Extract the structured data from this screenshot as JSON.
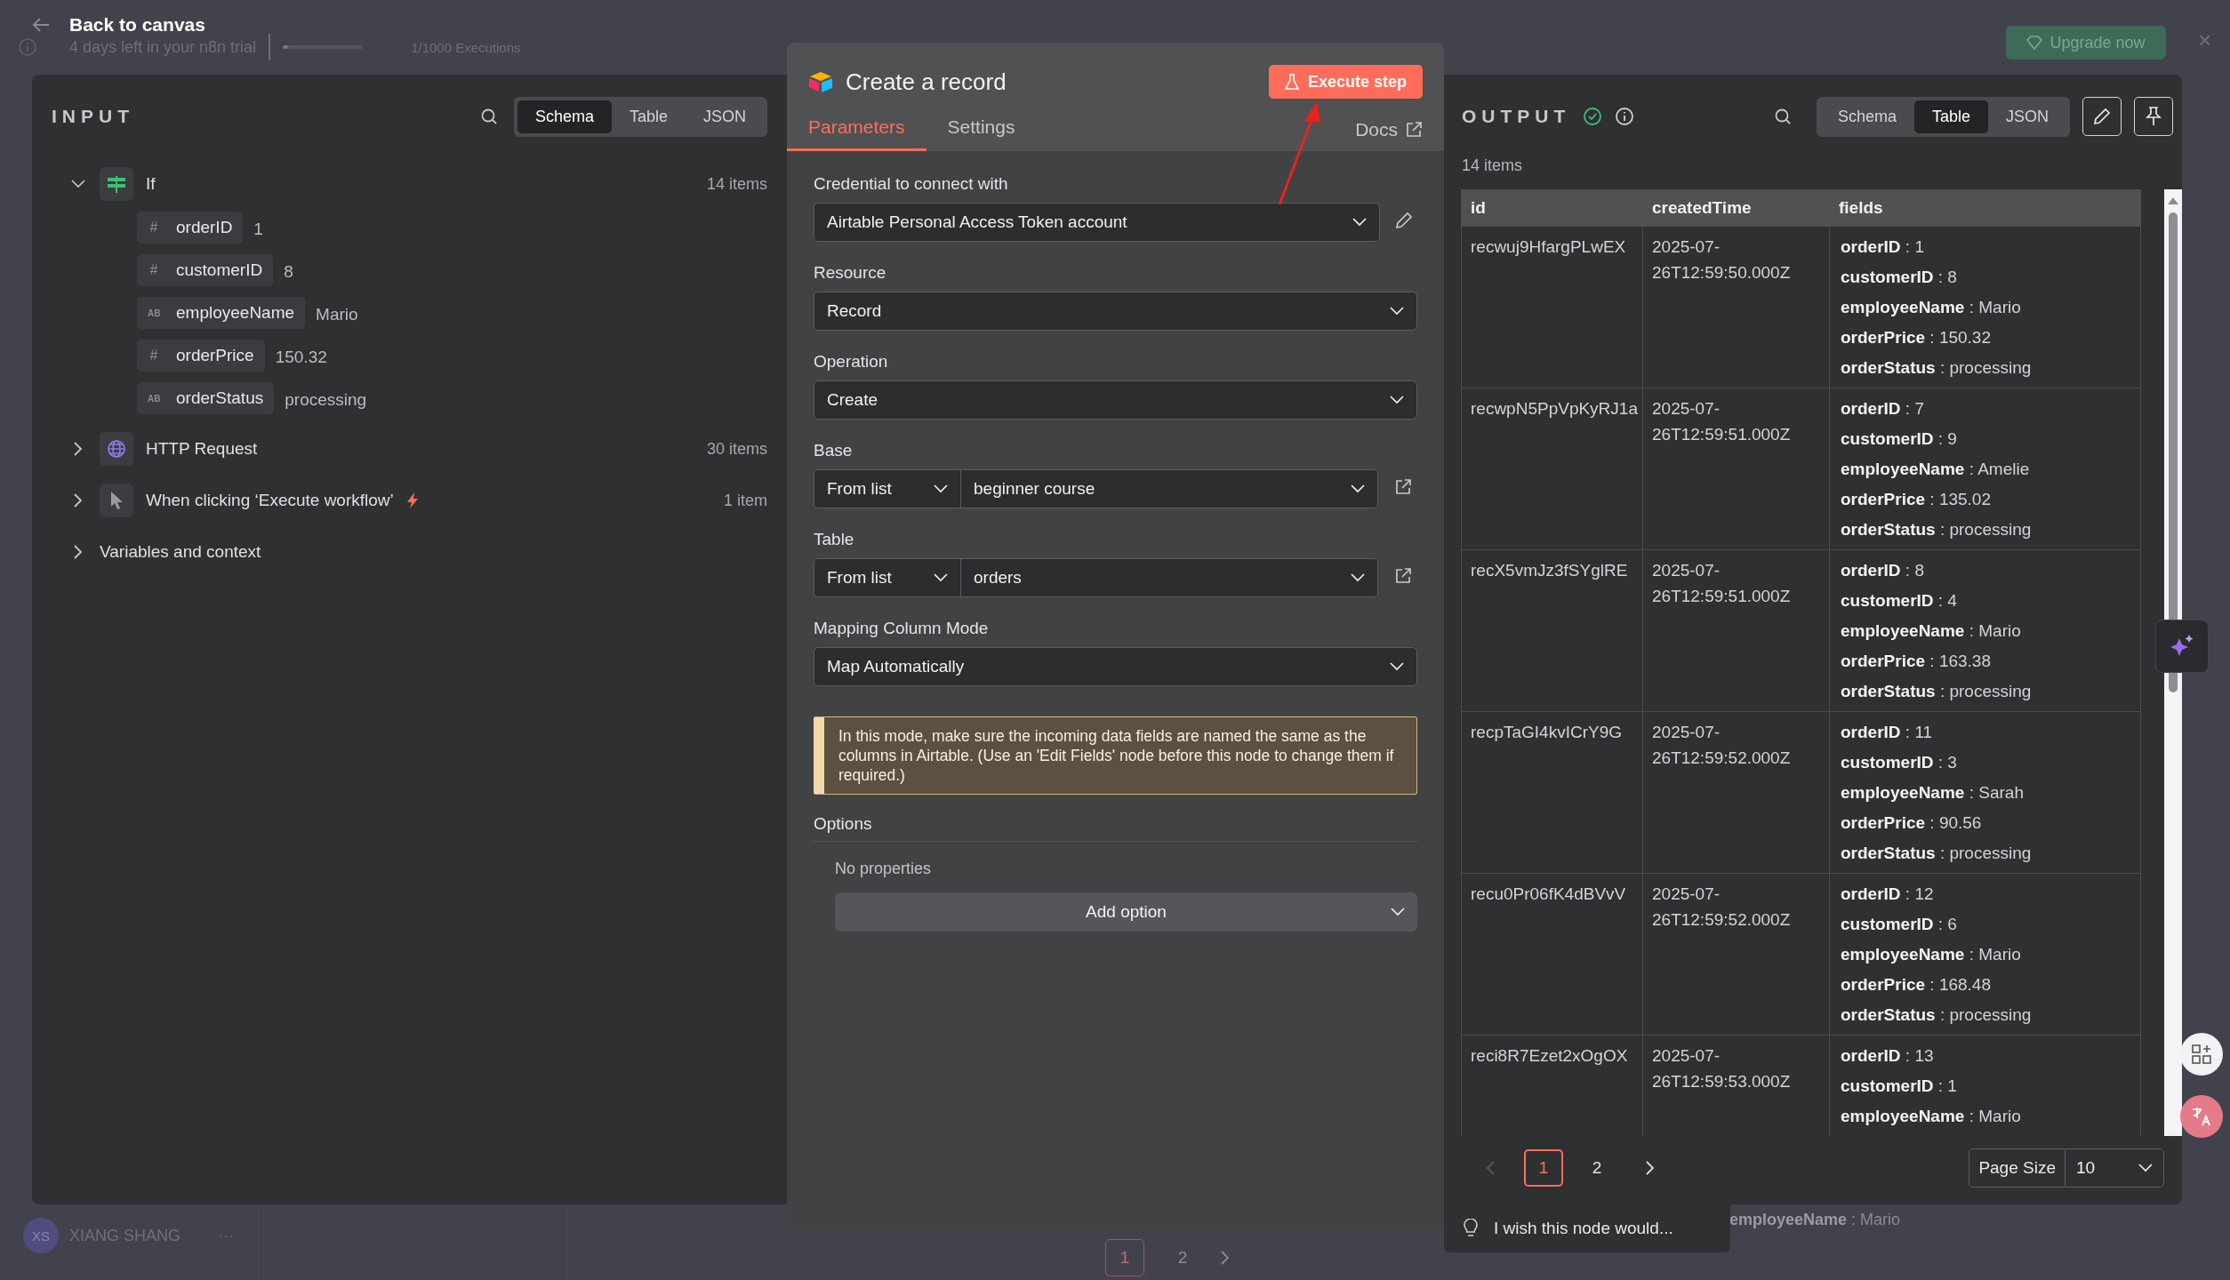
{
  "topbar": {
    "back_label": "Back to canvas",
    "trial_text": "4 days left in your n8n trial",
    "executions": {
      "label": "1/1000 Executions",
      "level": 0.01
    },
    "upgrade_button": "Upgrade now",
    "close": "×"
  },
  "user": {
    "initials": "XS",
    "name": "XIANG SHANG",
    "more": "···"
  },
  "background_pagination": [
    {
      "label": "1",
      "selected": true
    },
    {
      "label": "2",
      "selected": false
    }
  ],
  "background_text": "**employeeName** : Mario",
  "input": {
    "title": "INPUT",
    "views": [
      {
        "label": "Schema",
        "selected": true
      },
      {
        "label": "Table",
        "selected": false
      },
      {
        "label": "JSON",
        "selected": false
      }
    ],
    "nodes": [
      {
        "kind": "if",
        "name": "If",
        "count": "14 items",
        "expanded": true,
        "fields": [
          {
            "type_label": "#",
            "key": "orderID",
            "value": "1"
          },
          {
            "type_label": "#",
            "key": "customerID",
            "value": "8"
          },
          {
            "type_label": "AB",
            "key": "employeeName",
            "value": "Mario"
          },
          {
            "type_label": "#",
            "key": "orderPrice",
            "value": "150.32"
          },
          {
            "type_label": "AB",
            "key": "orderStatus",
            "value": "processing"
          }
        ]
      },
      {
        "kind": "http",
        "name": "HTTP Request",
        "count": "30 items",
        "expanded": false
      },
      {
        "kind": "trigger",
        "name": "When clicking ‘Execute workflow’",
        "count": "1 item",
        "expanded": false
      },
      {
        "kind": "plain",
        "name": "Variables and context",
        "expanded": false
      }
    ]
  },
  "editor": {
    "title": "Create a record",
    "execute_button": "Execute step",
    "tabs": [
      {
        "label": "Parameters",
        "selected": true
      },
      {
        "label": "Settings",
        "selected": false
      }
    ],
    "docs": "Docs",
    "params": [
      {
        "kind": "credential",
        "label": "Credential to connect with",
        "value": "Airtable Personal Access Token account"
      },
      {
        "kind": "select",
        "label": "Resource",
        "value": "Record"
      },
      {
        "kind": "select",
        "label": "Operation",
        "value": "Create"
      },
      {
        "kind": "locator",
        "label": "Base",
        "mode": "From list",
        "value": "beginner course"
      },
      {
        "kind": "locator",
        "label": "Table",
        "mode": "From list",
        "value": "orders"
      },
      {
        "kind": "select",
        "label": "Mapping Column Mode",
        "value": "Map Automatically"
      },
      {
        "kind": "notice",
        "text": "In this mode, make sure the incoming data fields are named the same as the columns in Airtable. (Use an 'Edit Fields' node before this node to change them if required.)"
      }
    ],
    "options": {
      "label": "Options",
      "empty": "No properties",
      "add_button": "Add option"
    }
  },
  "output": {
    "title": "OUTPUT",
    "count": "14 items",
    "views": [
      {
        "label": "Schema",
        "selected": false
      },
      {
        "label": "Table",
        "selected": true
      },
      {
        "label": "JSON",
        "selected": false
      }
    ],
    "columns": [
      "id",
      "createdTime",
      "fields"
    ],
    "rows": [
      {
        "id": "recwuj9HfargPLwEX",
        "created": "2025-07-26T12:59:50.000Z",
        "fields": [
          "**orderID** : 1",
          "**customerID** : 8",
          "**employeeName** : Mario",
          "**orderPrice** : 150.32",
          "**orderStatus** : processing"
        ]
      },
      {
        "id": "recwpN5PpVpKyRJ1a",
        "created": "2025-07-26T12:59:51.000Z",
        "fields": [
          "**orderID** : 7",
          "**customerID** : 9",
          "**employeeName** : Amelie",
          "**orderPrice** : 135.02",
          "**orderStatus** : processing"
        ]
      },
      {
        "id": "recX5vmJz3fSYglRE",
        "created": "2025-07-26T12:59:51.000Z",
        "fields": [
          "**orderID** : 8",
          "**customerID** : 4",
          "**employeeName** : Mario",
          "**orderPrice** : 163.38",
          "**orderStatus** : processing"
        ]
      },
      {
        "id": "recpTaGI4kvICrY9G",
        "created": "2025-07-26T12:59:52.000Z",
        "fields": [
          "**orderID** : 11",
          "**customerID** : 3",
          "**employeeName** : Sarah",
          "**orderPrice** : 90.56",
          "**orderStatus** : processing"
        ]
      },
      {
        "id": "recu0Pr06fK4dBVvV",
        "created": "2025-07-26T12:59:52.000Z",
        "fields": [
          "**orderID** : 12",
          "**customerID** : 6",
          "**employeeName** : Mario",
          "**orderPrice** : 168.48",
          "**orderStatus** : processing"
        ]
      },
      {
        "id": "reci8R7Ezet2xOgOX",
        "created": "2025-07-26T12:59:53.000Z",
        "fields": [
          "**orderID** : 13",
          "**customerID** : 1",
          "**employeeName** : Mario"
        ]
      }
    ],
    "pagination": {
      "pages": [
        {
          "label": "1",
          "selected": true
        },
        {
          "label": "2",
          "selected": false
        }
      ],
      "page_size_label": "Page Size",
      "page_size": "10"
    },
    "feedback": "I wish this node would..."
  }
}
